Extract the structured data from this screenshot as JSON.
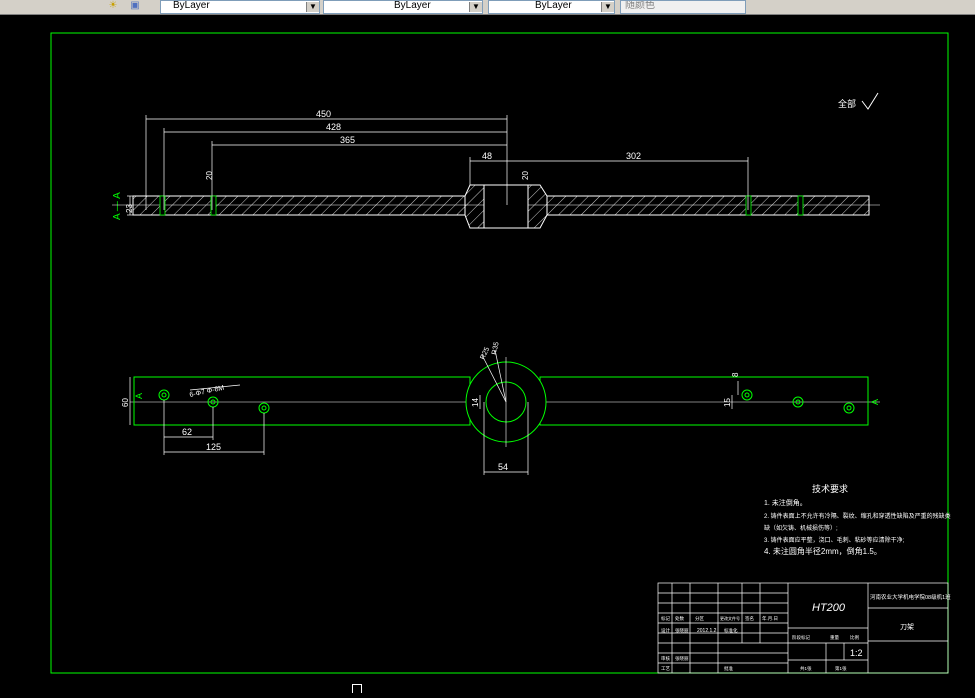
{
  "toolbar": {
    "layer_selector_label": "ByLayer",
    "linetype_selector_label": "ByLayer",
    "lineweight_selector_label": "ByLayer",
    "plotstyle_selector_label": "随颜色",
    "icons": [
      "layer-state-icon",
      "layer-previous-icon"
    ]
  },
  "drawing": {
    "section_label": "A — A",
    "roughness_note": "全部",
    "front_view": {
      "dims_top": [
        "450",
        "428",
        "365"
      ],
      "dim_48": "48",
      "dim_302": "302",
      "dim_20_left": "20",
      "dim_20_center": "20",
      "dim_23": "23"
    },
    "top_view": {
      "dim_60": "60",
      "dim_62": "62",
      "dim_125": "125",
      "dim_14": "14",
      "dim_15": "15",
      "dim_8": "8",
      "dim_54": "54",
      "dim_r1": "R25",
      "dim_r2": "R35",
      "hole_callout": "6-Φ7  Φ-8M",
      "section_mark_left": "A",
      "section_mark_right": "A"
    },
    "tech_requirements": {
      "heading": "技术要求",
      "items": [
        "1. 未注倒角。",
        "2. 铸件表面上不允许有冷隔、裂纹、缩孔和穿透性缺陷及严重的残缺类",
        "缺（如欠铸、机械损伤等）;",
        "3. 铸件表面应平整，浇口、毛刺、粘砂等应清除干净;",
        "4. 未注圆角半径2mm，倒角1.5。"
      ]
    },
    "title_block": {
      "material": "HT200",
      "university": "河南农业大学机电学院08级机1班",
      "part_name": "刀架",
      "scale": "1:2",
      "date": "2012.1.2",
      "rows": [
        "标记",
        "处数",
        "分区",
        "更改文件号",
        "签名",
        "年.月.日"
      ],
      "designer_label": "设计",
      "standardize_label": "标准化",
      "review_label": "审核",
      "process_label": "工艺",
      "approve_label": "批准",
      "stage_label": "阶段标记",
      "weight_label": "重量",
      "scale_label": "比例",
      "sheet_label": "共1张",
      "sheet_no_label": "第1张",
      "designer_name": "张晓丽",
      "review_name": "张晓丽"
    }
  },
  "colors": {
    "frame": "#00ff00",
    "geometry": "#ffffff",
    "dimension": "#ffffff",
    "hatch": "#ffffff",
    "background": "#000000"
  }
}
